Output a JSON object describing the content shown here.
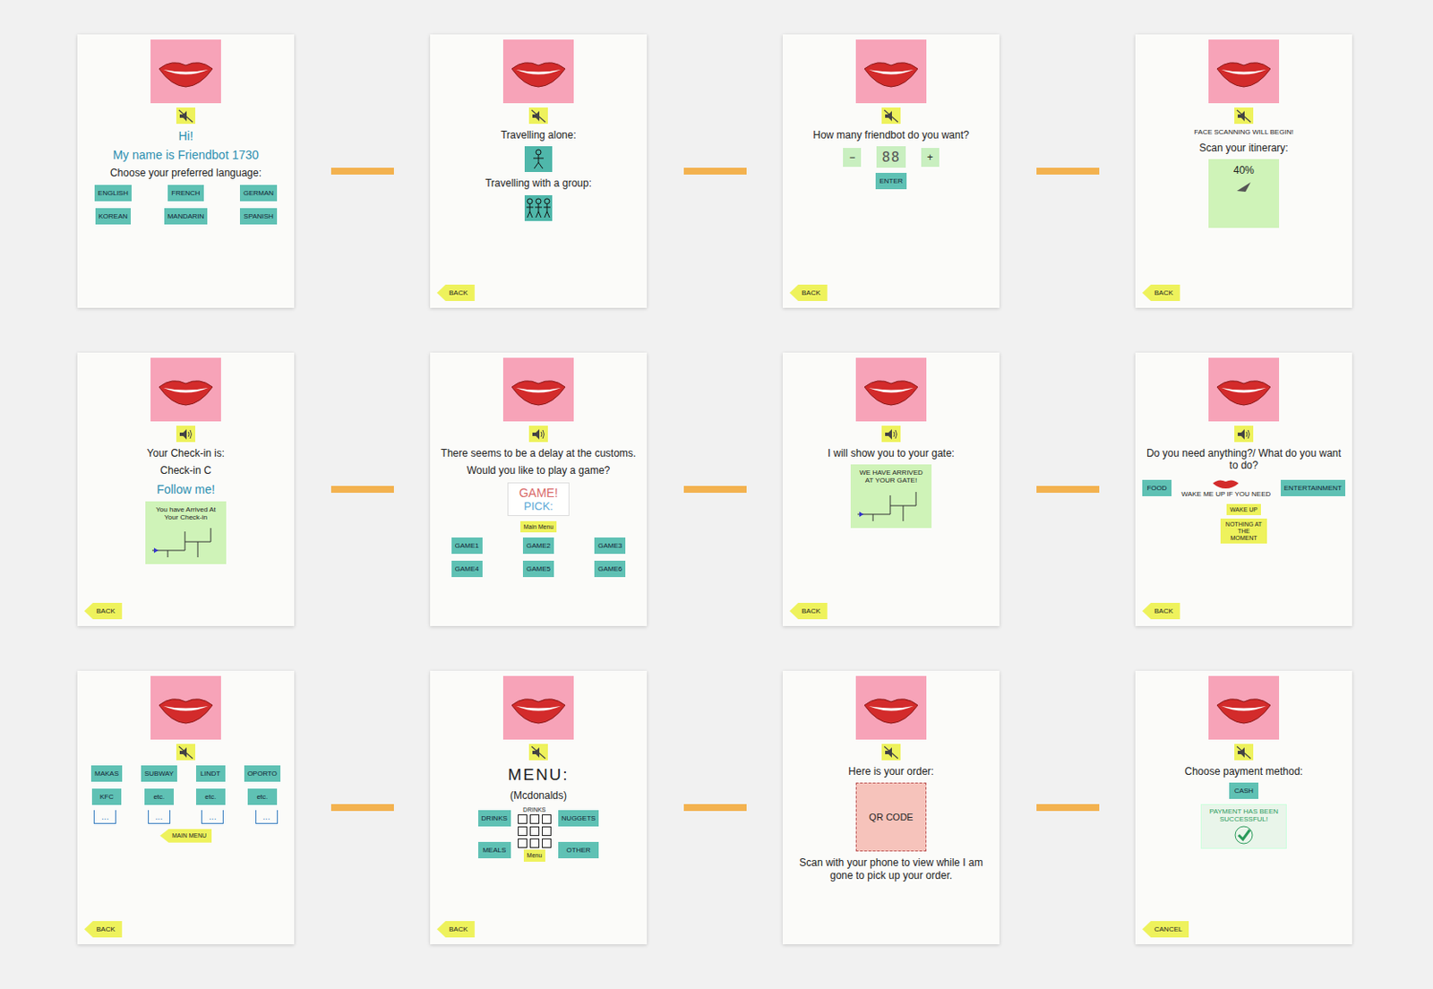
{
  "screens": [
    {
      "muted": true,
      "back": null,
      "elements": [
        {
          "kind": "title",
          "text": "Hi!"
        },
        {
          "kind": "title",
          "text": "My name is Friendbot 1730"
        },
        {
          "kind": "text",
          "text": "Choose your preferred language:"
        },
        {
          "kind": "grid3",
          "items": [
            "ENGLISH",
            "FRENCH",
            "GERMAN",
            "KOREAN",
            "MANDARIN",
            "SPANISH"
          ]
        }
      ]
    },
    {
      "muted": true,
      "back": "BACK",
      "elements": [
        {
          "kind": "text",
          "text": "Travelling alone:"
        },
        {
          "kind": "person"
        },
        {
          "kind": "text",
          "text": "Travelling with a group:"
        },
        {
          "kind": "group"
        }
      ]
    },
    {
      "muted": true,
      "back": "BACK",
      "elements": [
        {
          "kind": "text",
          "text": "How many friendbot do you want?"
        },
        {
          "kind": "counter",
          "minus": "−",
          "value": "88",
          "plus": "+"
        },
        {
          "kind": "grid1",
          "items": [
            "ENTER"
          ]
        }
      ]
    },
    {
      "muted": true,
      "back": "BACK",
      "elements": [
        {
          "kind": "small",
          "text": "FACE SCANNING WILL BEGIN!"
        },
        {
          "kind": "text",
          "text": "Scan your itinerary:"
        },
        {
          "kind": "scan",
          "text": "40%"
        }
      ]
    },
    {
      "muted": false,
      "back": "BACK",
      "elements": [
        {
          "kind": "text",
          "text": "Your Check-in is:"
        },
        {
          "kind": "text",
          "text": "Check-in C"
        },
        {
          "kind": "title",
          "text": "Follow me!"
        },
        {
          "kind": "map",
          "text": "You have Arrived At Your Check-in"
        }
      ]
    },
    {
      "muted": false,
      "back": null,
      "elements": [
        {
          "kind": "text",
          "text": "There seems to be a delay at the customs."
        },
        {
          "kind": "text",
          "text": "Would you like to play a game?"
        },
        {
          "kind": "overlay",
          "lines": [
            "GAME!",
            "PICK:"
          ]
        },
        {
          "kind": "yellow",
          "items": [
            "Main Menu"
          ]
        },
        {
          "kind": "grid3",
          "items": [
            "GAME1",
            "GAME2",
            "GAME3",
            "GAME4",
            "GAME5",
            "GAME6"
          ]
        }
      ]
    },
    {
      "muted": false,
      "back": "BACK",
      "elements": [
        {
          "kind": "text",
          "text": "I will show you to your gate:"
        },
        {
          "kind": "map",
          "text": "WE HAVE ARRIVED AT YOUR GATE!"
        }
      ]
    },
    {
      "muted": false,
      "back": "BACK",
      "elements": [
        {
          "kind": "text",
          "text": "Do you need anything?/ What do you want to do?"
        },
        {
          "kind": "choices",
          "left": "FOOD",
          "middle": "WAKE ME UP IF YOU NEED",
          "right": "ENTERTAINMENT"
        },
        {
          "kind": "yellow",
          "items": [
            "WAKE UP",
            "NOTHING AT THE MOMENT"
          ]
        }
      ]
    },
    {
      "muted": true,
      "back": "BACK",
      "elements": [
        {
          "kind": "grid4",
          "items": [
            "MAKAS",
            "SUBWAY",
            "LINDT",
            "OPORTO",
            "KFC",
            "etc.",
            "etc.",
            "etc."
          ]
        },
        {
          "kind": "outline4",
          "items": [
            "...",
            "...",
            "...",
            "..."
          ]
        },
        {
          "kind": "arrow",
          "text": "MAIN MENU"
        }
      ]
    },
    {
      "muted": true,
      "back": "BACK",
      "elements": [
        {
          "kind": "heading",
          "text": "MENU:"
        },
        {
          "kind": "text",
          "text": "(Mcdonalds)"
        },
        {
          "kind": "menu",
          "title": "DRINKS",
          "left": [
            "DRINKS",
            "MEALS"
          ],
          "right": [
            "NUGGETS",
            "OTHER"
          ],
          "tab": "Menu"
        }
      ]
    },
    {
      "muted": true,
      "back": null,
      "elements": [
        {
          "kind": "text",
          "text": "Here is your order:"
        },
        {
          "kind": "qr",
          "text": "QR CODE"
        },
        {
          "kind": "text",
          "text": "Scan with your phone to view while I am gone to pick up your order."
        }
      ]
    },
    {
      "muted": true,
      "back": "CANCEL",
      "elements": [
        {
          "kind": "text",
          "text": "Choose payment method:"
        },
        {
          "kind": "grid1",
          "items": [
            "CASH"
          ]
        },
        {
          "kind": "success",
          "text": "PAYMENT HAS BEEN SUCCESSFUL!"
        }
      ]
    }
  ]
}
